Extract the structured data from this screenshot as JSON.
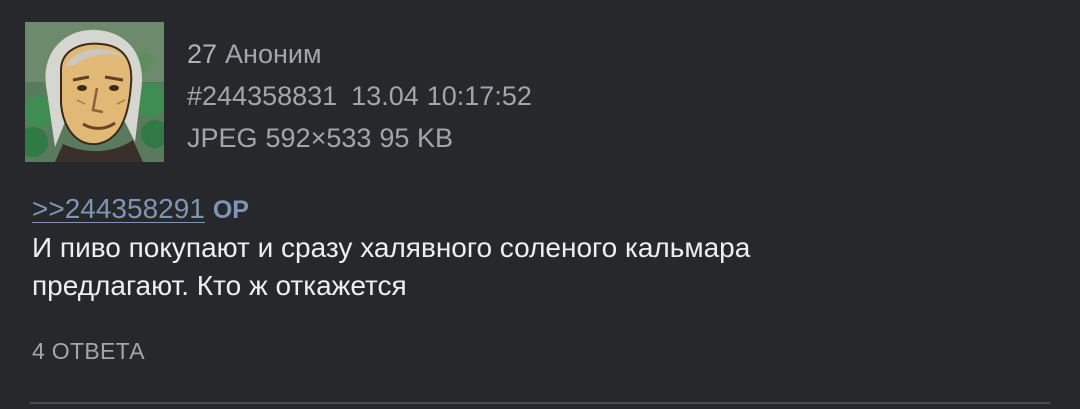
{
  "post": {
    "index": "27",
    "author": "Аноним",
    "post_id": "#244358831",
    "date": "13.04",
    "time": "10:17:52",
    "file_type": "JPEG",
    "file_dims": "592×533",
    "file_size": "95 KB",
    "reply_link": ">>244358291",
    "op_tag": "OP",
    "text_line1": "И пиво покупают и сразу халявного соленого кальмара",
    "text_line2": "предлагают. Кто ж откажется",
    "replies_label": "4 ОТВЕТА"
  },
  "colors": {
    "background": "#27282c",
    "link": "#7f95b5",
    "meta_text": "#a3a5ab",
    "body_text": "#eeeeee"
  }
}
